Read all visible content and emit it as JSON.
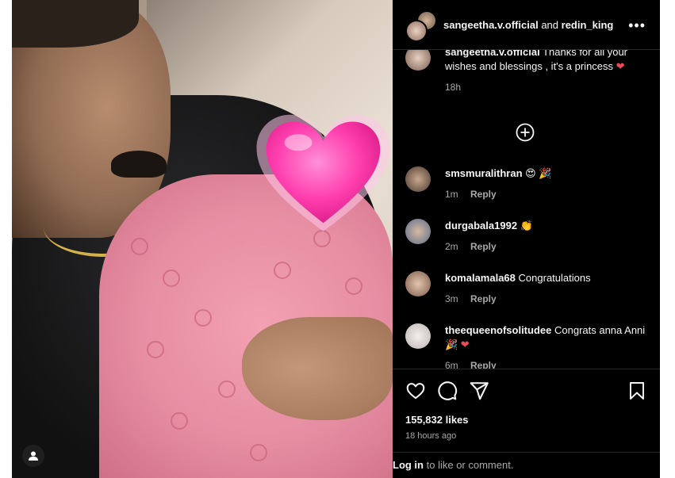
{
  "post": {
    "author": "sangeetha.v.official",
    "joiner": "and",
    "coauthor": "redin_king",
    "more_label": "•••"
  },
  "comments": [
    {
      "user": "sangeetha.v.official",
      "text": "Thanks for all your wishes and blessings , it's a princess",
      "emoji": "❤",
      "time": "18h",
      "reply": ""
    },
    {
      "user": "smsmuralithran",
      "text": "",
      "emoji": "😍 🎉",
      "time": "1m",
      "reply": "Reply"
    },
    {
      "user": "durgabala1992",
      "text": "",
      "emoji": "👏",
      "time": "2m",
      "reply": "Reply"
    },
    {
      "user": "komalamala68",
      "text": "Congratulations",
      "emoji": "",
      "time": "3m",
      "reply": "Reply"
    },
    {
      "user": "theequeenofsolitudee",
      "text": "Congrats anna Anni",
      "emoji": "🎉 ❤",
      "time": "6m",
      "reply": "Reply"
    }
  ],
  "load_more_icon": "plus-circle-icon",
  "actions": {
    "like_icon": "heart-icon",
    "comment_icon": "comment-icon",
    "share_icon": "send-icon",
    "save_icon": "bookmark-icon"
  },
  "likes_label": "155,832 likes",
  "posted_ago": "18 hours ago",
  "login": {
    "link": "Log in",
    "rest": "to like or comment."
  },
  "colors": {
    "background": "#000000",
    "text": "#f5f5f5",
    "muted": "#a8a8a8",
    "divider": "#262626",
    "heart": "#ed4956"
  }
}
